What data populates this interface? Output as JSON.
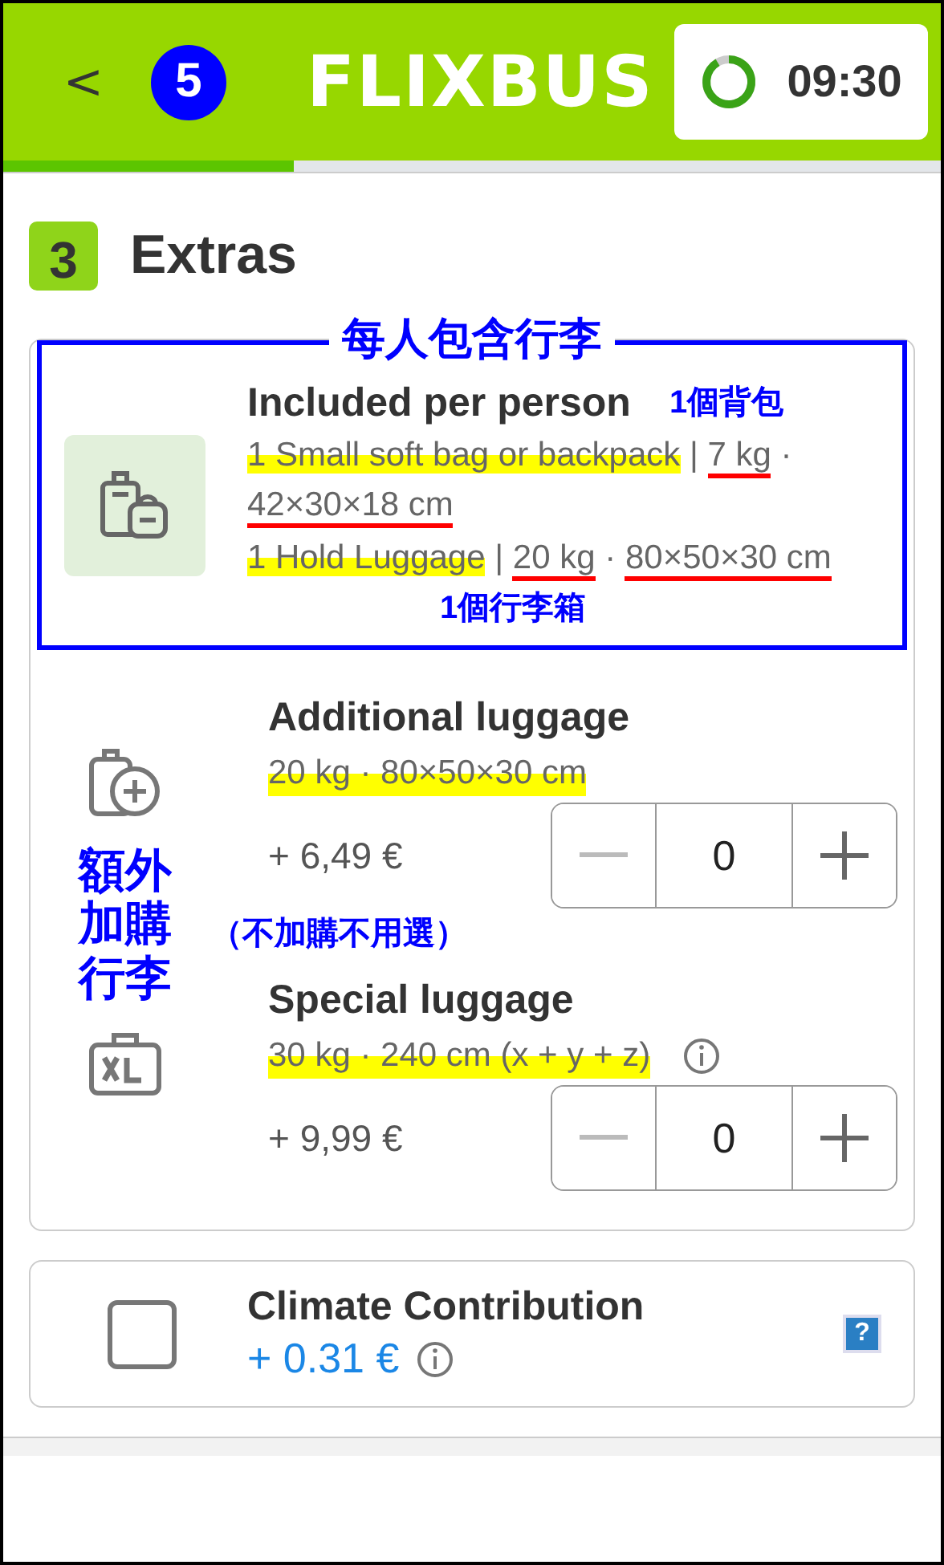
{
  "header": {
    "back": "<",
    "step_badge": "5",
    "logo": "FLIXBUS",
    "timer": "09:30",
    "progress": {
      "level": 0.31
    }
  },
  "section": {
    "number": "3",
    "title": "Extras"
  },
  "included": {
    "annotation_title": "每人包含行李",
    "title": "Included per person",
    "note_backpack": "1個背包",
    "note_suitcase": "1個行李箱",
    "lines": [
      [
        {
          "text": "1 Small soft bag or backpack",
          "kind": "highlight"
        },
        {
          "text": " | ",
          "kind": "plain"
        },
        {
          "text": "7 kg",
          "kind": "underline"
        },
        {
          "text": " · ",
          "kind": "plain"
        },
        {
          "text": "42×30×18 cm",
          "kind": "underline"
        }
      ],
      [
        {
          "text": "1 Hold Luggage",
          "kind": "highlight"
        },
        {
          "text": " | ",
          "kind": "plain"
        },
        {
          "text": "20 kg",
          "kind": "underline"
        },
        {
          "text": " · ",
          "kind": "plain"
        },
        {
          "text": "80×50×30 cm",
          "kind": "underline"
        }
      ]
    ]
  },
  "extras": {
    "annotation_side": "額外加購行李",
    "annotation_hint": "（不加購不用選）",
    "items": [
      {
        "kind": "additional",
        "title": "Additional luggage",
        "spec": "20 kg · 80×50×30 cm",
        "info": false,
        "price": "+ 6,49 €",
        "quantity": "0",
        "minus_disabled": true
      },
      {
        "kind": "special",
        "title": "Special luggage",
        "spec": "30 kg · 240 cm (x + y + z)",
        "info": true,
        "price": "+ 9,99 €",
        "quantity": "0",
        "minus_disabled": true
      }
    ]
  },
  "climate": {
    "checked": false,
    "title": "Climate Contribution",
    "price": "+ 0.31 €",
    "help": "?"
  }
}
